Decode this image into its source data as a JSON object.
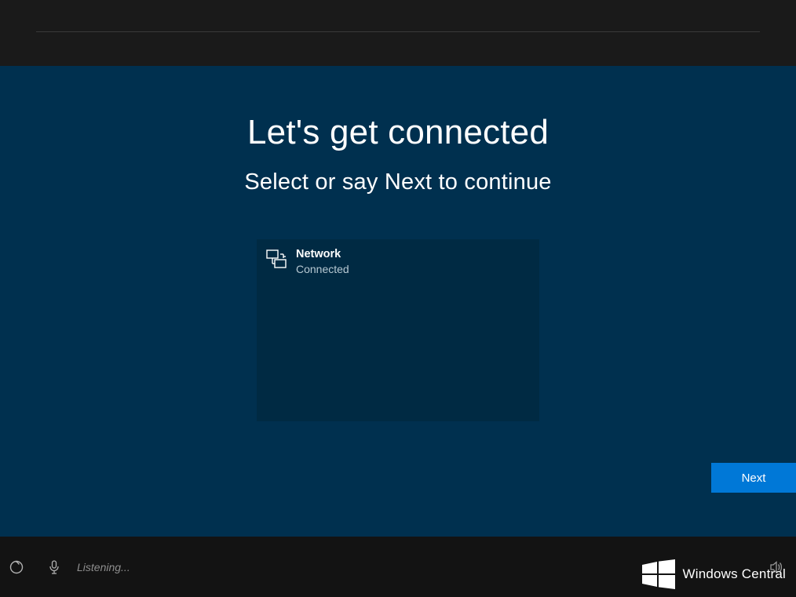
{
  "main": {
    "title": "Let's get connected",
    "subtitle": "Select or say Next to continue",
    "network": {
      "icon": "ethernet-icon",
      "name": "Network",
      "status": "Connected"
    },
    "next_label": "Next"
  },
  "bottom": {
    "listening_label": "Listening...",
    "watermark_label": "Windows Central"
  },
  "colors": {
    "main_bg": "#00304f",
    "list_bg": "#002a43",
    "accent": "#0078d7",
    "bottom_bg": "#131313"
  }
}
